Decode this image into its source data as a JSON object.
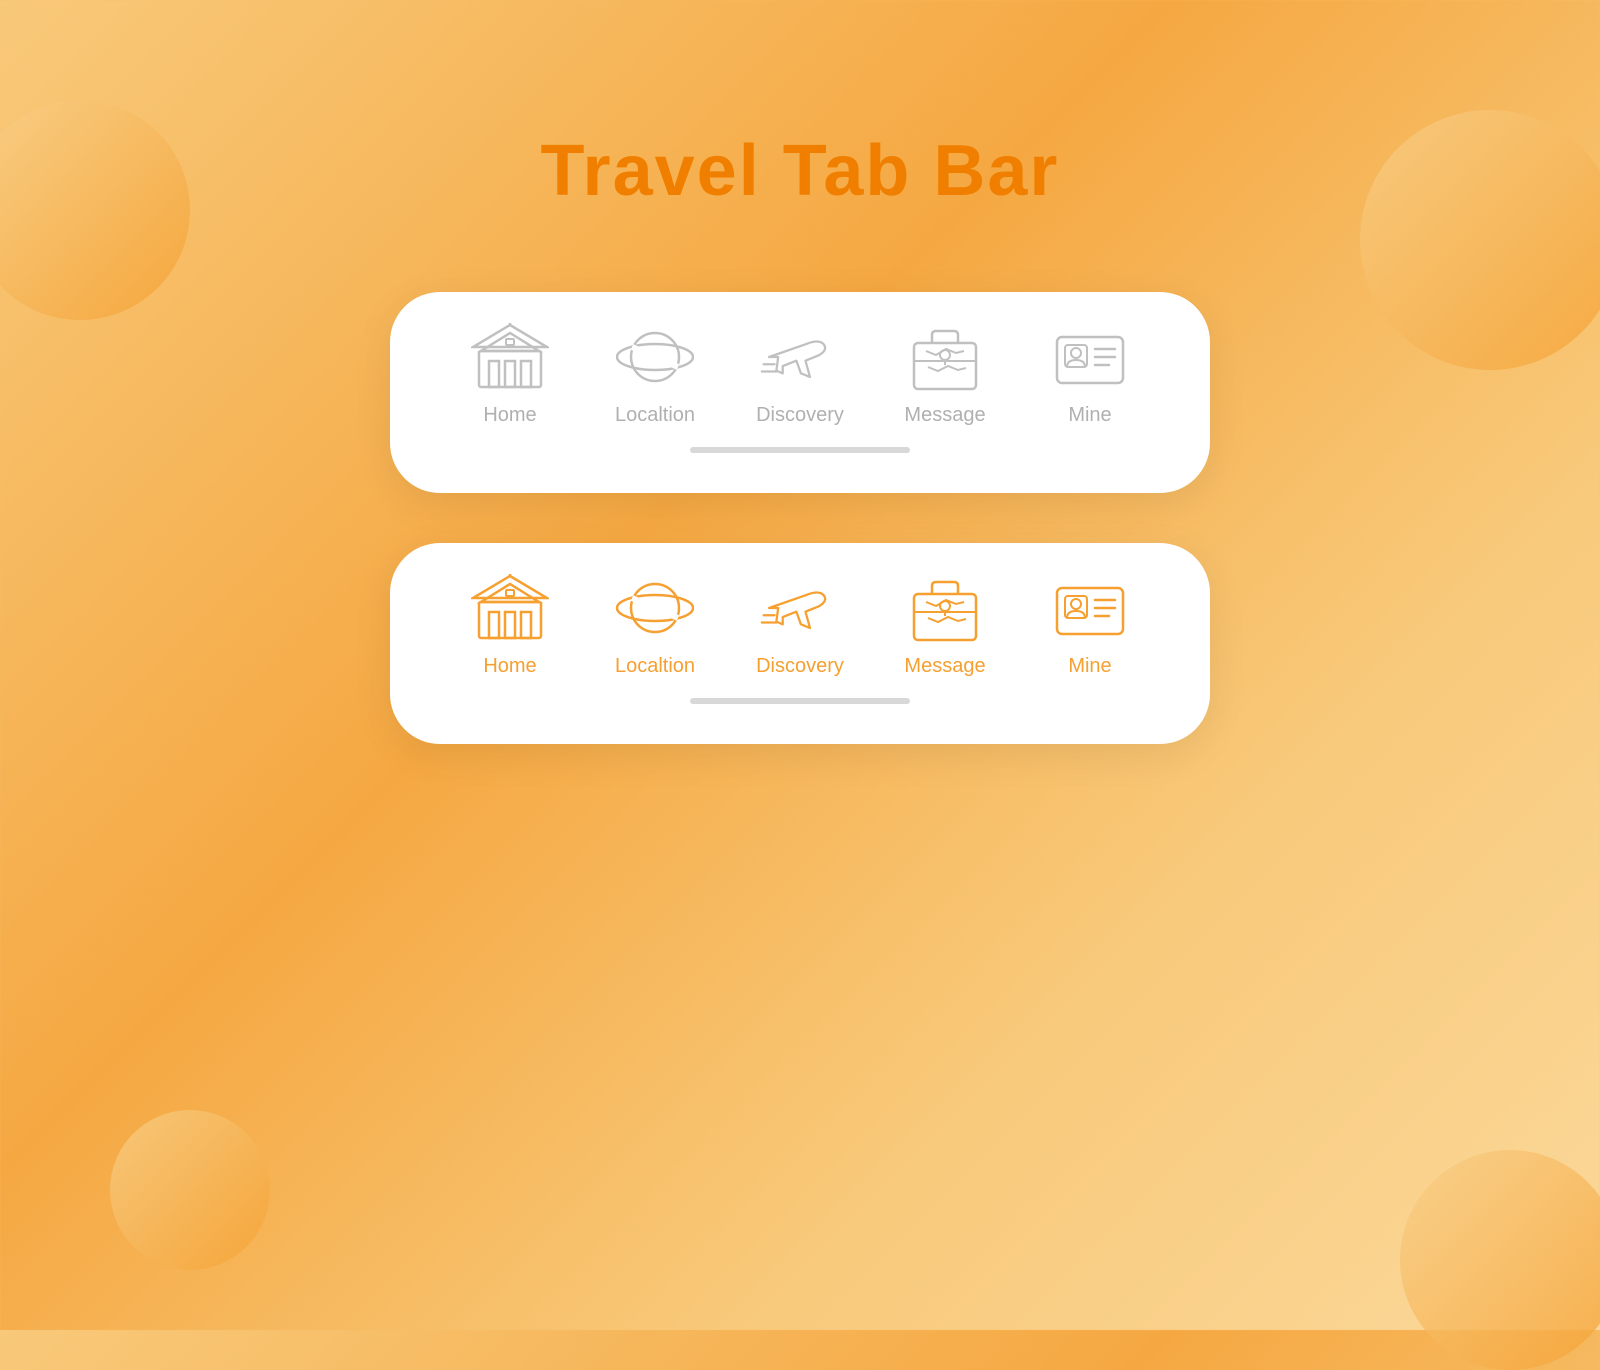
{
  "page": {
    "title": "Travel Tab Bar",
    "title_color": "#f07f00"
  },
  "tab_bar_inactive": {
    "tabs": [
      {
        "id": "home",
        "label": "Home"
      },
      {
        "id": "location",
        "label": "Localtion"
      },
      {
        "id": "discovery",
        "label": "Discovery"
      },
      {
        "id": "message",
        "label": "Message"
      },
      {
        "id": "mine",
        "label": "Mine"
      }
    ]
  },
  "tab_bar_active": {
    "tabs": [
      {
        "id": "home",
        "label": "Home"
      },
      {
        "id": "location",
        "label": "Localtion"
      },
      {
        "id": "discovery",
        "label": "Discovery"
      },
      {
        "id": "message",
        "label": "Message"
      },
      {
        "id": "mine",
        "label": "Mine"
      }
    ]
  }
}
